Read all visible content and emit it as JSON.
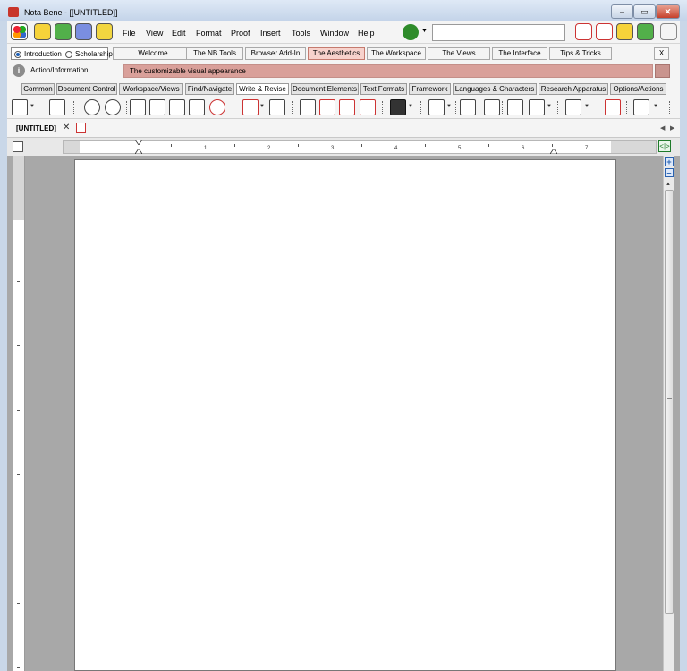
{
  "window": {
    "title": "Nota Bene - [[UNTITLED]]",
    "close_label": "✕",
    "min_label": "–",
    "max_label": "▭"
  },
  "menu": {
    "items": [
      "File",
      "View",
      "Edit",
      "Format",
      "Proof",
      "Insert",
      "Tools",
      "Window",
      "Help"
    ],
    "search_value": ""
  },
  "tabs": {
    "radio_introduction": "Introduction",
    "radio_scholarship": "Scholarship",
    "items": [
      "Welcome",
      "The NB Tools",
      "Browser Add-In",
      "The Aesthetics",
      "The Workspace",
      "The Views",
      "The Interface",
      "Tips & Tricks"
    ],
    "active": "The Aesthetics",
    "close_label": "X"
  },
  "info": {
    "label": "Action/Information:",
    "text": "The customizable visual appearance"
  },
  "categories": {
    "items": [
      "Common",
      "Document Control",
      "Workspace/Views",
      "Find/Navigate",
      "Write & Revise",
      "Document Elements",
      "Text Formats",
      "Framework",
      "Languages & Characters",
      "Research Apparatus",
      "Options/Actions"
    ],
    "active": "Write & Revise"
  },
  "document": {
    "tab_title": "[UNTITLED]",
    "tab_close": "✕",
    "split_label": "<|>"
  },
  "ruler": {
    "numbers": [
      "1",
      "2",
      "3",
      "4",
      "5",
      "6",
      "7"
    ]
  },
  "scroll": {
    "zoom_in": "+",
    "zoom_out": "–",
    "up": "▲"
  },
  "colors": {
    "accent_red": "#c33333",
    "info_bar": "#d9a09a",
    "active_tab": "#f7d2cc",
    "title_bar": "#c4d4e9"
  }
}
